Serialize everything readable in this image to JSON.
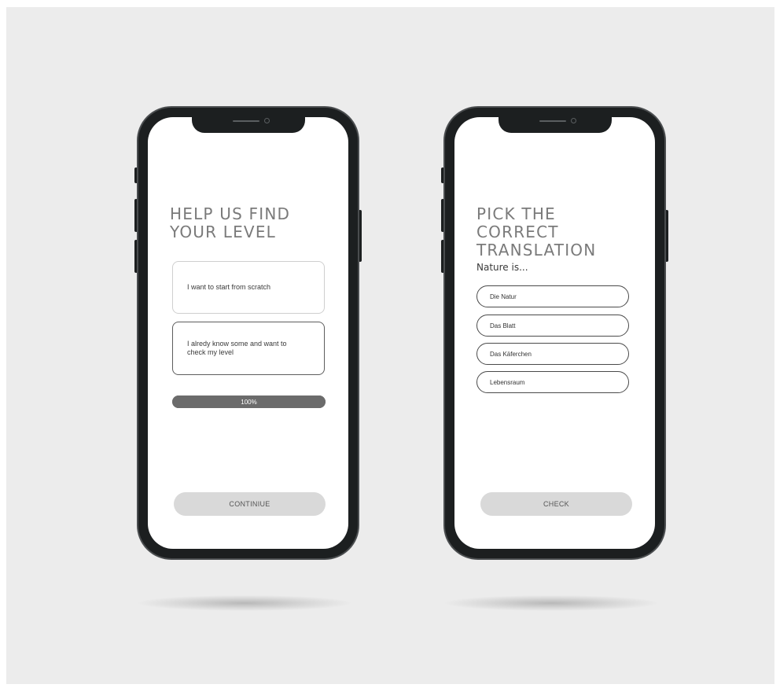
{
  "left_screen": {
    "title": "HELP US FIND YOUR LEVEL",
    "options": [
      {
        "label": "I want to start from scratch"
      },
      {
        "label": "I alredy know some and want to check my level"
      }
    ],
    "progress": {
      "value_percent": 100,
      "label": "100%"
    },
    "continue_label": "CONTINIUE"
  },
  "right_screen": {
    "title": "PICK THE CORRECT TRANSLATION",
    "prompt": "Nature is...",
    "answers": [
      {
        "label": "Die Natur"
      },
      {
        "label": "Das Blatt"
      },
      {
        "label": "Das Käferchen"
      },
      {
        "label": "Lebensraum"
      }
    ],
    "check_label": "CHECK"
  },
  "colors": {
    "background": "#ececec",
    "phone_body": "#1c1f20",
    "button_fill": "#d9d9d9",
    "progress_fill": "#6b6b6b"
  }
}
